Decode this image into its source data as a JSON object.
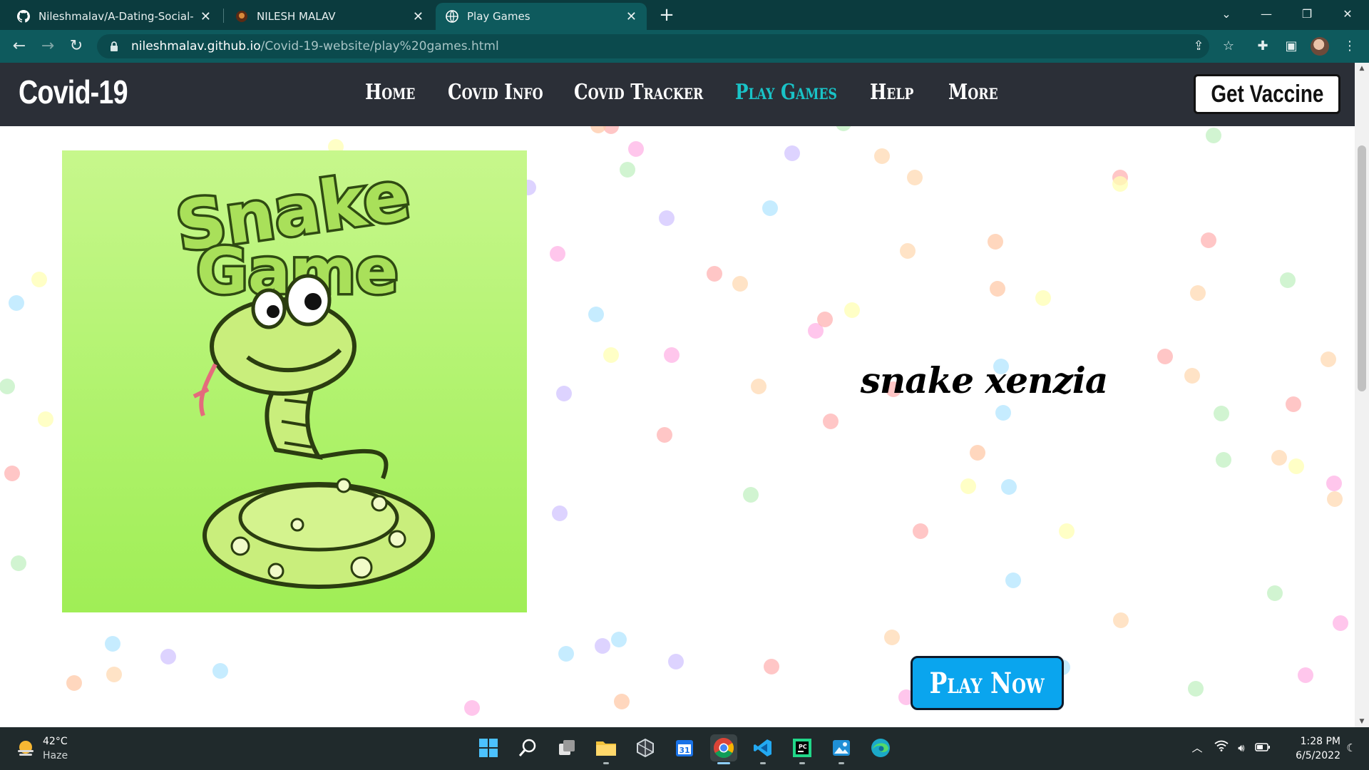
{
  "browser": {
    "tabs": [
      {
        "title": "Nileshmalav/A-Dating-Social-Me",
        "favicon": "github-icon",
        "active": false
      },
      {
        "title": "NILESH MALAV",
        "favicon": "site-favicon",
        "active": false
      },
      {
        "title": "Play Games",
        "favicon": "globe-icon",
        "active": true
      }
    ],
    "url_host": "nileshmalav.github.io",
    "url_path": "/Covid-19-website/play%20games.html"
  },
  "site": {
    "brand": "Covid-19",
    "nav": [
      {
        "label": "Home",
        "active": false
      },
      {
        "label": "Covid Info",
        "active": false
      },
      {
        "label": "Covid Tracker",
        "active": false
      },
      {
        "label": "Play Games",
        "active": true
      },
      {
        "label": "Help",
        "active": false
      },
      {
        "label": "More",
        "active": false
      }
    ],
    "cta_label": "Get Vaccine"
  },
  "game": {
    "image_title_line1": "Snake",
    "image_title_line2": "Game",
    "name": "snake xenzia",
    "play_label": "Play Now"
  },
  "taskbar": {
    "temperature": "42°C",
    "condition": "Haze",
    "time": "1:28 PM",
    "date": "6/5/2022",
    "calendar_day": "31"
  },
  "colors": {
    "chrome_dark": "#0b3b3e",
    "chrome_toolbar": "#0e5a5d",
    "site_nav": "#2b2f37",
    "nav_active": "#19c3c7",
    "play_button": "#0aa5ee",
    "snake_card": "#aef26a"
  }
}
